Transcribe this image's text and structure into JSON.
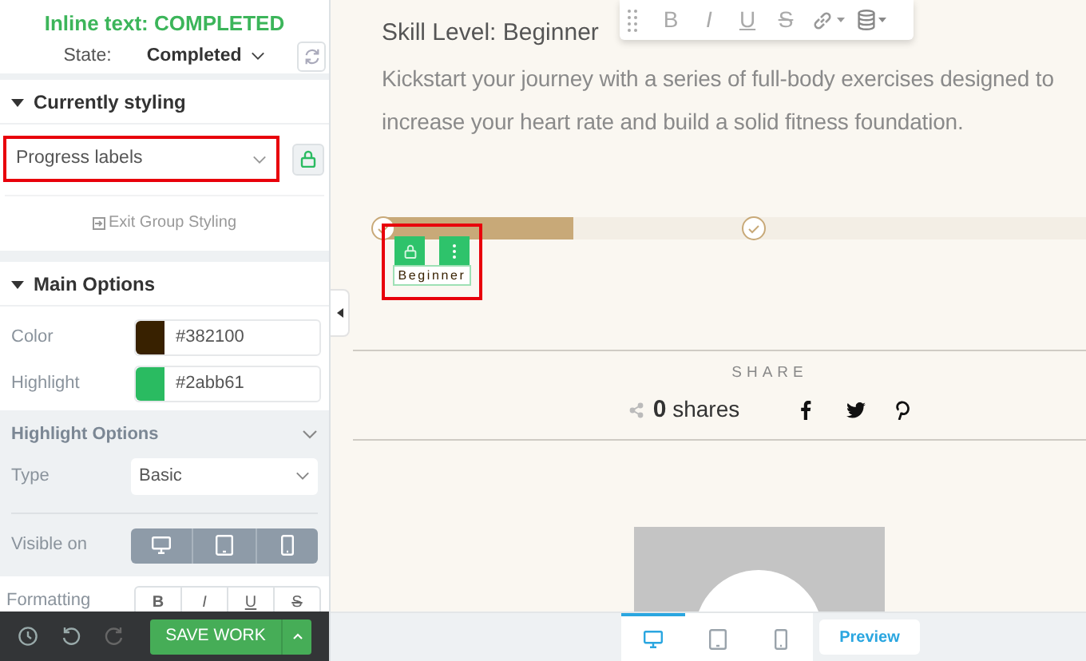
{
  "sidebar": {
    "heading": "Inline text: COMPLETED",
    "state_label": "State:",
    "state_value": "Completed",
    "currently_styling": {
      "title": "Currently styling",
      "expanded": true,
      "select": "Progress labels",
      "highlighted": true,
      "exit_link": "Exit Group Styling"
    },
    "main_options": {
      "title": "Main Options",
      "expanded": true,
      "colors": [
        {
          "label": "Color",
          "value": "#382100",
          "color": "#382100"
        },
        {
          "label": "Highlight",
          "value": "#2abb61",
          "color": "#2abb61"
        }
      ],
      "highlight_options": {
        "title": "Highlight Options",
        "type_label": "Type",
        "type_value": "Basic",
        "visible_label": "Visible on",
        "devices": [
          {
            "kind": "desktop",
            "on": true
          },
          {
            "kind": "tablet",
            "on": true
          },
          {
            "kind": "phone",
            "on": true
          }
        ]
      },
      "formatting_label": "Formatting",
      "format_buttons": [
        {
          "kind": "bold",
          "label": "B"
        },
        {
          "kind": "italic",
          "label": "I"
        },
        {
          "kind": "underline",
          "label": "U"
        },
        {
          "kind": "strike",
          "label": "S"
        }
      ]
    }
  },
  "footer": {
    "save": "SAVE WORK"
  },
  "canvas": {
    "title": "Skill Level: Beginner",
    "description": "Kickstart your journey with a series of full-body exercises designed to increase your heart rate and build a solid fitness foundation.",
    "toolbar": [
      {
        "kind": "bold",
        "label": "B"
      },
      {
        "kind": "italic",
        "label": "I"
      },
      {
        "kind": "underline",
        "label": "U"
      },
      {
        "kind": "strike",
        "label": "S"
      },
      {
        "kind": "link"
      },
      {
        "kind": "database"
      }
    ],
    "progress": {
      "level": 0.27,
      "label": "Beginner",
      "highlighted": true
    },
    "share": {
      "heading": "SHARE",
      "count": "0",
      "count_label": "shares"
    }
  },
  "view_bar": {
    "devices": [
      {
        "kind": "desktop",
        "selected": true
      },
      {
        "kind": "tablet",
        "selected": false
      },
      {
        "kind": "phone",
        "selected": false
      }
    ],
    "preview": "Preview"
  }
}
